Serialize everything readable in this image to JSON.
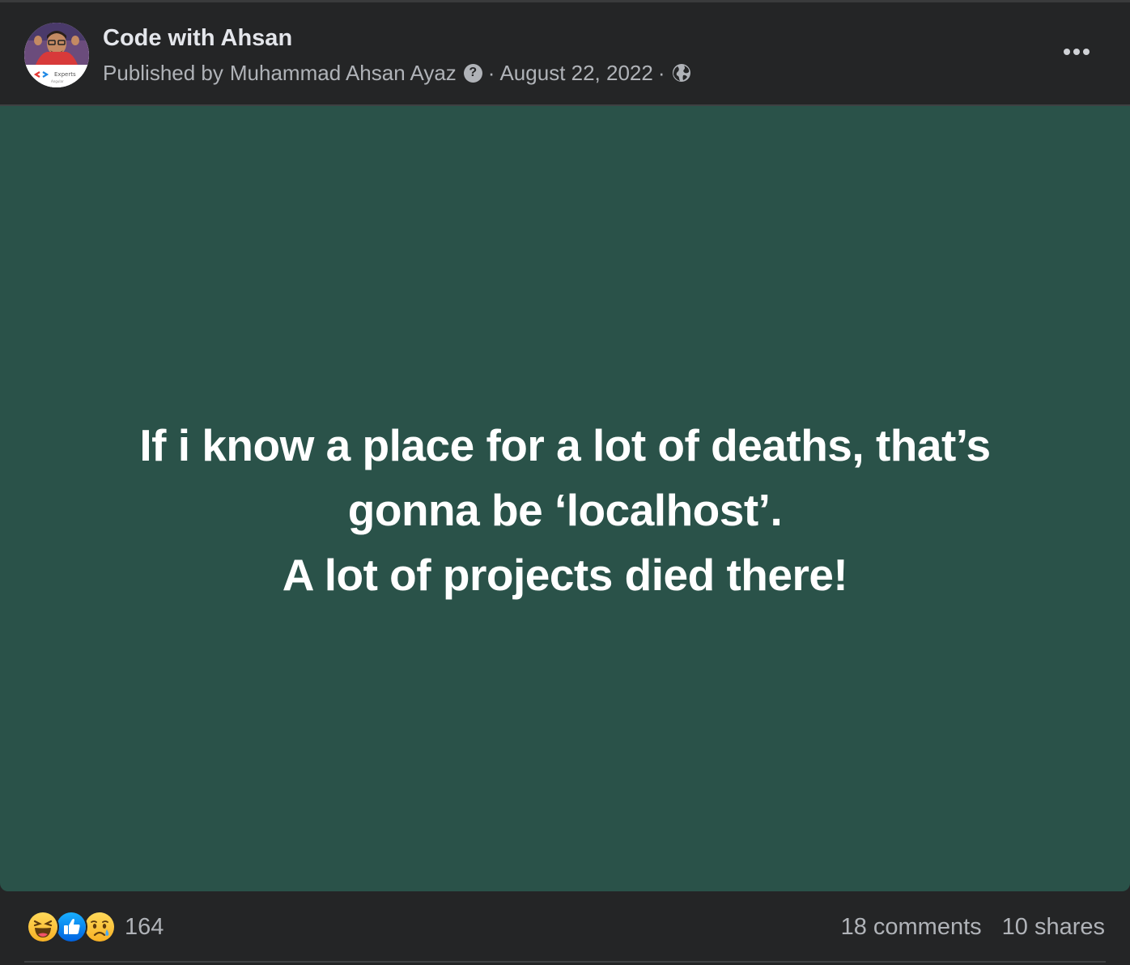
{
  "post": {
    "page_name": "Code with Ahsan",
    "published_by_prefix": "Published by",
    "author": "Muhammad Ahsan Ayaz",
    "help_symbol": "?",
    "separator": "·",
    "date": "August 22, 2022",
    "audience_icon": "globe-icon",
    "more_icon": "more-options-icon",
    "avatar_badge_text": "Experts",
    "avatar_badge_subtext": "Angular"
  },
  "content": {
    "background_color": "#2a5249",
    "lines": [
      "If i know a place for a lot of deaths, that’s",
      "gonna be ‘localhost’.",
      "A lot of projects died there!"
    ]
  },
  "engagement": {
    "reactions": [
      "haha-icon",
      "like-icon",
      "sad-icon"
    ],
    "reaction_count": "164",
    "comments": "18 comments",
    "shares": "10 shares"
  }
}
